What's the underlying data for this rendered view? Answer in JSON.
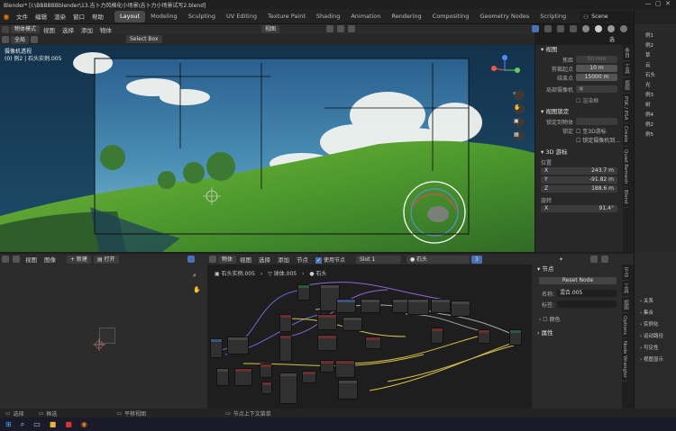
{
  "window": {
    "title": "Blender* [I:\\BBBBBBblender\\13.吉卜力风格化小场景\\吉卜力小场景试写2.blend]"
  },
  "menu": [
    "文件",
    "编辑",
    "渲染",
    "窗口",
    "帮助"
  ],
  "workspaces": [
    {
      "label": "Layout",
      "active": true
    },
    {
      "label": "Modeling"
    },
    {
      "label": "Sculpting"
    },
    {
      "label": "UV Editing"
    },
    {
      "label": "Texture Paint"
    },
    {
      "label": "Shading"
    },
    {
      "label": "Animation"
    },
    {
      "label": "Rendering"
    },
    {
      "label": "Compositing"
    },
    {
      "label": "Geometry Nodes"
    },
    {
      "label": "Scripting"
    }
  ],
  "scene_label": "Scene",
  "viewport": {
    "mode": "物体模式",
    "menus": [
      "视图",
      "选择",
      "添加",
      "物体"
    ],
    "view_menu": "视图",
    "select_box": "Select Box",
    "orientation": "全局",
    "options": "选项",
    "overlay_title": "摄像机透视",
    "overlay_sub": "(0) 例2 | 石头实例.005"
  },
  "npanel": {
    "section_view": "视图",
    "focal_label": "焦距",
    "focal_value": "50 mm",
    "clip_start_label": "剪裁起点",
    "clip_start_value": "10 m",
    "clip_end_label": "结束点",
    "clip_end_value": "15000 m",
    "local_camera_label": "局部摄像机",
    "render_region": "渲染框",
    "section_lock": "视图锁定",
    "lock_obj_label": "锁定到物体",
    "lock_label": "锁定",
    "lock_3d_cursor": "至3D游标",
    "lock_cam_view": "锁定摄像机到...",
    "section_cursor": "3D 游标",
    "location_label": "位置",
    "x_label": "X",
    "x_value": "243.7 m",
    "y_label": "Y",
    "y_value": "-91.82 m",
    "z_label": "Z",
    "z_value": "188.6 m",
    "rotation_label": "旋转",
    "rx_label": "X",
    "rx_value": "91.4°",
    "tabs": [
      "条目",
      "工具",
      "视图",
      "PSK / PSA",
      "Create",
      "Quad Remesh",
      "Blend"
    ]
  },
  "outliner": {
    "items": [
      "例1",
      "例2",
      "草",
      "云",
      "石头",
      "光",
      "例3",
      "树",
      "例4",
      "例2",
      "例5"
    ]
  },
  "image_editor": {
    "menus": [
      "视图",
      "图像"
    ],
    "new_label": "+ 新建",
    "open_label": "打开"
  },
  "node_editor": {
    "type": "物体",
    "menus": [
      "视图",
      "选择",
      "添加",
      "节点"
    ],
    "use_nodes": "使用节点",
    "slot": "Slot 1",
    "material": "石头",
    "count": "3",
    "breadcrumb": [
      "石头实例.005",
      "球体.005",
      "石头"
    ]
  },
  "node_panel": {
    "section": "节点",
    "reset": "Reset Node",
    "name_label": "名称:",
    "name_value": "混合.005",
    "label_label": "标签:",
    "color": "颜色",
    "properties": "属性",
    "tabs": [
      "节点",
      "工具",
      "视图",
      "Options",
      "Node Wrangler"
    ]
  },
  "props_right": {
    "items": [
      "关系",
      "集合",
      "实例化",
      "运动路径",
      "可见性",
      "视图显示"
    ]
  },
  "statusbar": {
    "select": "选择",
    "box_select": "框选",
    "pan_view": "平移视图",
    "node_ctx": "节点上下文菜单"
  }
}
